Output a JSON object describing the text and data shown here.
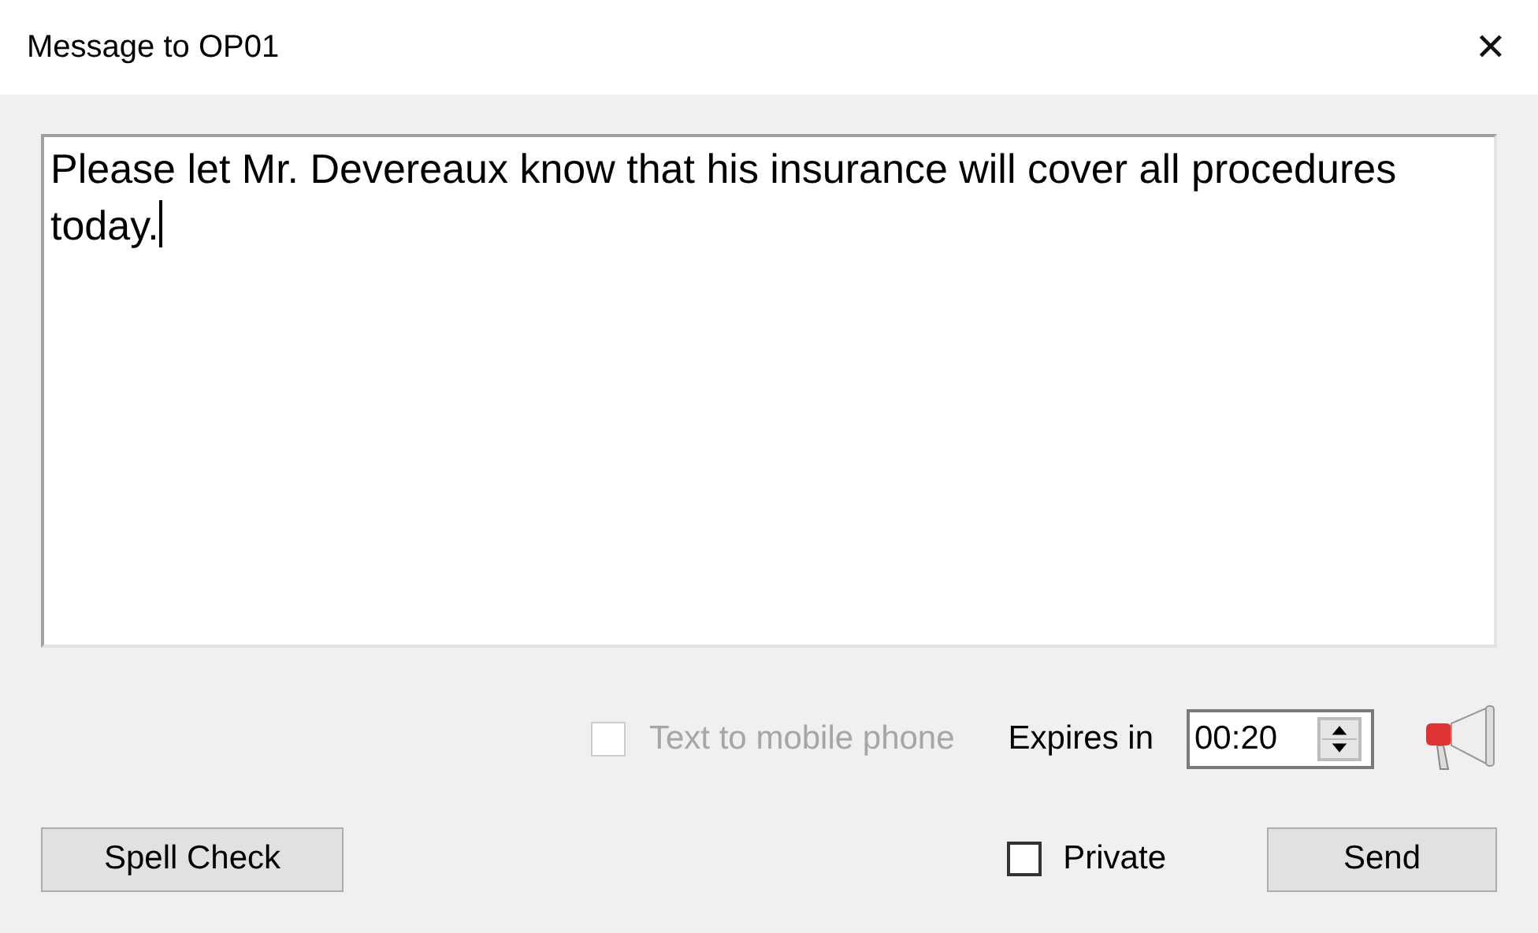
{
  "window": {
    "title": "Message to OP01",
    "close": "✕"
  },
  "message": {
    "value": "Please let Mr. Devereaux know that his insurance will cover all procedures today."
  },
  "options": {
    "mobile": {
      "label": "Text to mobile phone",
      "checked": false,
      "disabled": true
    },
    "expires": {
      "label": "Expires in",
      "value": "00:20"
    }
  },
  "private": {
    "label": "Private",
    "checked": false
  },
  "buttons": [
    {
      "kind": "spell",
      "label": "Spell Check"
    },
    {
      "kind": "send",
      "label": "Send"
    }
  ]
}
